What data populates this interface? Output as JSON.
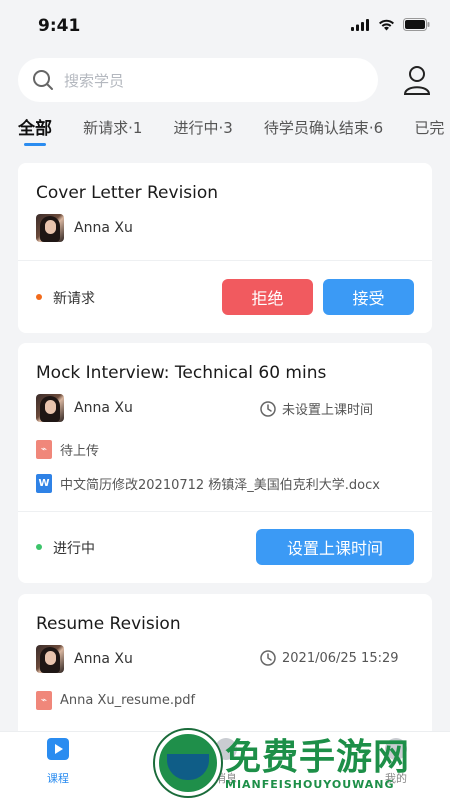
{
  "status_bar": {
    "time": "9:41"
  },
  "search": {
    "placeholder": "搜索学员"
  },
  "tabs": [
    {
      "label": "全部",
      "active": true
    },
    {
      "label": "新请求·1"
    },
    {
      "label": "进行中·3"
    },
    {
      "label": "待学员确认结束·6"
    },
    {
      "label": "已完"
    }
  ],
  "cards": [
    {
      "title": "Cover Letter Revision",
      "student": "Anna Xu",
      "status": {
        "label": "新请求",
        "color": "#f26a1b"
      },
      "actions": {
        "reject": "拒绝",
        "accept": "接受"
      }
    },
    {
      "title": "Mock Interview: Technical 60 mins",
      "student": "Anna Xu",
      "schedule": "未设置上课时间",
      "upload_status": "待上传",
      "file": "中文简历修改20210712 杨镇泽_美国伯克利大学.docx",
      "status": {
        "label": "进行中",
        "color": "#3cc46a"
      },
      "actions": {
        "set_time": "设置上课时间"
      }
    },
    {
      "title": "Resume Revision",
      "student": "Anna Xu",
      "schedule": "2021/06/25 15:29",
      "file": "Anna Xu_resume.pdf"
    }
  ],
  "bottom_nav": [
    {
      "label": "课程",
      "active": true,
      "icon": "play-icon"
    },
    {
      "label": "消息",
      "icon": "message-icon"
    },
    {
      "label": "我的",
      "icon": "user-icon"
    }
  ],
  "watermark": {
    "title": "免费手游网",
    "subtitle": "MIANFEISHOUYOUWANG"
  },
  "colors": {
    "accent": "#3b9af5",
    "danger": "#f15a5f",
    "background": "#f3f4f6"
  }
}
